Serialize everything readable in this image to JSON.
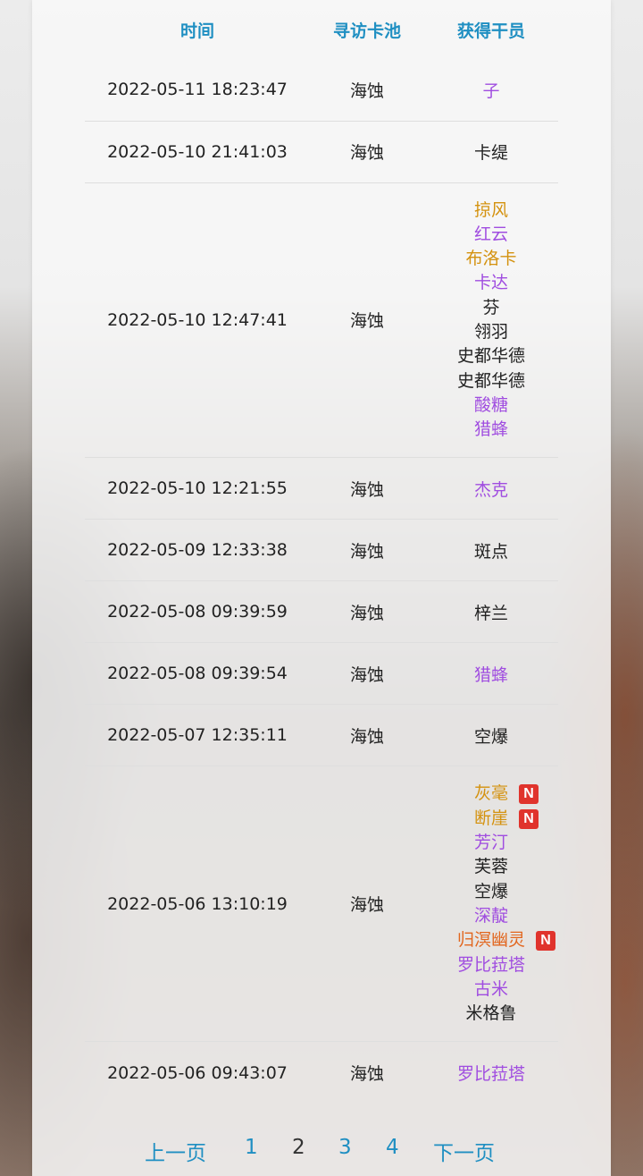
{
  "table": {
    "headers": {
      "time": "时间",
      "pool": "寻访卡池",
      "operator": "获得干员"
    },
    "records": [
      {
        "time": "2022-05-11 18:23:47",
        "pool": "海蚀",
        "ops": [
          {
            "name": "子",
            "color": "#a04de0",
            "new": false
          }
        ]
      },
      {
        "time": "2022-05-10 21:41:03",
        "pool": "海蚀",
        "ops": [
          {
            "name": "卡缇",
            "color": "#222222",
            "new": false
          }
        ]
      },
      {
        "time": "2022-05-10 12:47:41",
        "pool": "海蚀",
        "ops": [
          {
            "name": "掠风",
            "color": "#d4920f",
            "new": false
          },
          {
            "name": "红云",
            "color": "#a04de0",
            "new": false
          },
          {
            "name": "布洛卡",
            "color": "#d4920f",
            "new": false
          },
          {
            "name": "卡达",
            "color": "#a04de0",
            "new": false
          },
          {
            "name": "芬",
            "color": "#222222",
            "new": false
          },
          {
            "name": "翎羽",
            "color": "#222222",
            "new": false
          },
          {
            "name": "史都华德",
            "color": "#222222",
            "new": false
          },
          {
            "name": "史都华德",
            "color": "#222222",
            "new": false
          },
          {
            "name": "酸糖",
            "color": "#a04de0",
            "new": false
          },
          {
            "name": "猎蜂",
            "color": "#a04de0",
            "new": false
          }
        ]
      },
      {
        "time": "2022-05-10 12:21:55",
        "pool": "海蚀",
        "ops": [
          {
            "name": "杰克",
            "color": "#a04de0",
            "new": false
          }
        ]
      },
      {
        "time": "2022-05-09 12:33:38",
        "pool": "海蚀",
        "ops": [
          {
            "name": "斑点",
            "color": "#222222",
            "new": false
          }
        ]
      },
      {
        "time": "2022-05-08 09:39:59",
        "pool": "海蚀",
        "ops": [
          {
            "name": "梓兰",
            "color": "#222222",
            "new": false
          }
        ]
      },
      {
        "time": "2022-05-08 09:39:54",
        "pool": "海蚀",
        "ops": [
          {
            "name": "猎蜂",
            "color": "#a04de0",
            "new": false
          }
        ]
      },
      {
        "time": "2022-05-07 12:35:11",
        "pool": "海蚀",
        "ops": [
          {
            "name": "空爆",
            "color": "#222222",
            "new": false
          }
        ]
      },
      {
        "time": "2022-05-06 13:10:19",
        "pool": "海蚀",
        "ops": [
          {
            "name": "灰毫",
            "color": "#d4920f",
            "new": true
          },
          {
            "name": "断崖",
            "color": "#d4920f",
            "new": true
          },
          {
            "name": "芳汀",
            "color": "#a04de0",
            "new": false
          },
          {
            "name": "芙蓉",
            "color": "#222222",
            "new": false
          },
          {
            "name": "空爆",
            "color": "#222222",
            "new": false
          },
          {
            "name": "深靛",
            "color": "#a04de0",
            "new": false
          },
          {
            "name": "归溟幽灵",
            "color": "#e2661e",
            "new": true
          },
          {
            "name": "罗比菈塔",
            "color": "#a04de0",
            "new": false
          },
          {
            "name": "古米",
            "color": "#a04de0",
            "new": false
          },
          {
            "name": "米格鲁",
            "color": "#222222",
            "new": false
          }
        ]
      },
      {
        "time": "2022-05-06 09:43:07",
        "pool": "海蚀",
        "ops": [
          {
            "name": "罗比菈塔",
            "color": "#a04de0",
            "new": false
          }
        ]
      }
    ],
    "new_badge": "N"
  },
  "pagination": {
    "prev_label": "上一页",
    "pages": [
      "1",
      "2",
      "3",
      "4"
    ],
    "current_page": "2",
    "next_label": "下一页"
  },
  "colors": {
    "header_accent": "#1f8fc2",
    "six_star": "#e2661e",
    "five_star": "#d4920f",
    "four_star": "#a04de0",
    "three_star": "#222222",
    "new_badge": "#e0332c"
  }
}
